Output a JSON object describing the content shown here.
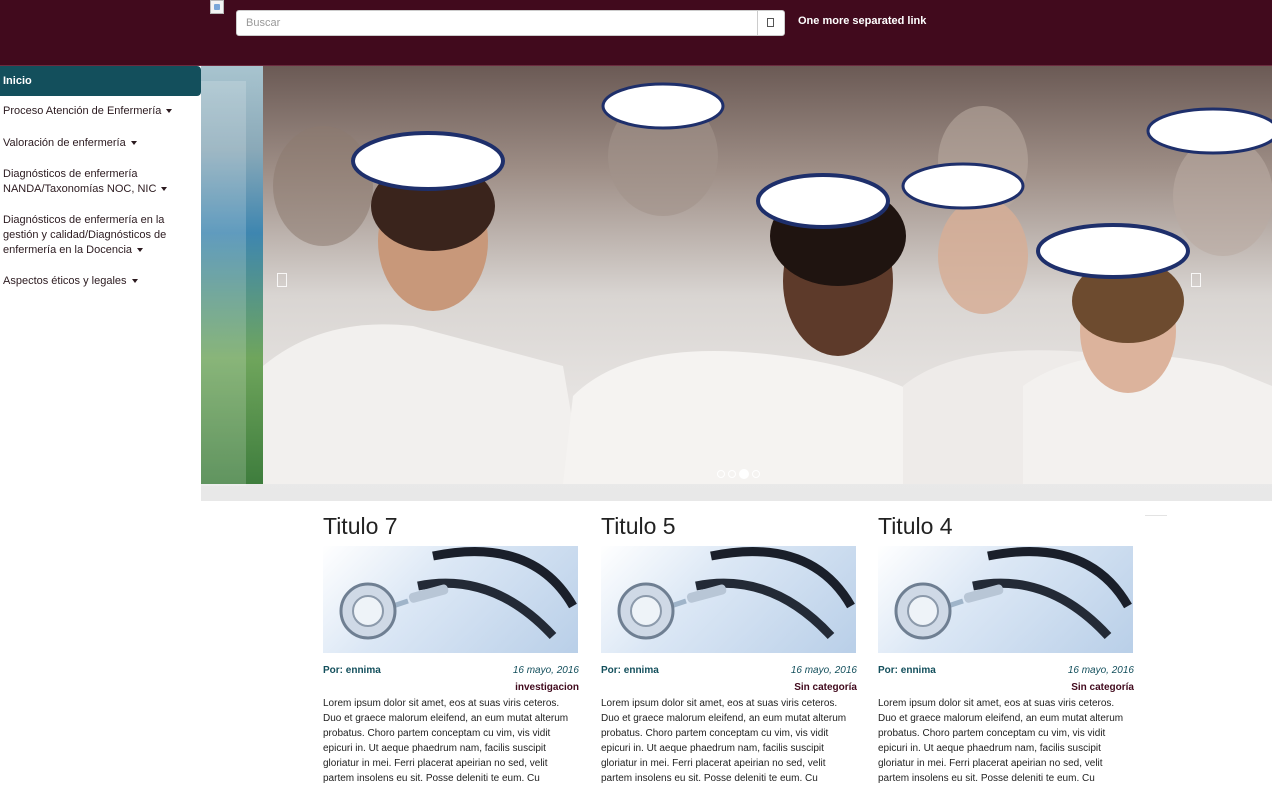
{
  "header": {
    "search_placeholder": "Buscar",
    "link": "One more separated link",
    "background_color": "#410a1d"
  },
  "sidebar": {
    "active_item": "Inicio",
    "items": [
      {
        "label": "Proceso Atención de Enfermería",
        "has_caret": true
      },
      {
        "label": "Valoración de enfermería",
        "has_caret": true
      },
      {
        "label": "Diagnósticos de enfermería NANDA/Taxonomías NOC, NIC",
        "has_caret": true
      },
      {
        "label": "Diagnósticos de enfermería en la gestión y calidad/Diagnósticos de enfermería en la Docencia",
        "has_caret": true
      },
      {
        "label": "Aspectos éticos y legales",
        "has_caret": true
      }
    ],
    "accent_color": "#134f5c"
  },
  "carousel": {
    "slide_description_icon": "nurses-photo",
    "indicator_count": 4,
    "active_indicator": 3
  },
  "posts": [
    {
      "title": "Titulo 7",
      "author": "Por: ennima",
      "date": "16 mayo, 2016",
      "category": "investigacion",
      "image_icon": "stethoscope-image",
      "excerpt": "Lorem ipsum dolor sit amet, eos at suas viris ceteros. Duo et graece malorum eleifend, an eum mutat alterum probatus. Choro partem conceptam cu vim, vis vidit epicuri in. Ut aeque phaedrum nam, facilis suscipit gloriatur in mei. Ferri placerat apeirian no sed, velit partem insolens eu sit. Posse deleniti te eum. Cu"
    },
    {
      "title": "Titulo 5",
      "author": "Por: ennima",
      "date": "16 mayo, 2016",
      "category": "Sin categoría",
      "image_icon": "stethoscope-image",
      "excerpt": "Lorem ipsum dolor sit amet, eos at suas viris ceteros. Duo et graece malorum eleifend, an eum mutat alterum probatus. Choro partem conceptam cu vim, vis vidit epicuri in. Ut aeque phaedrum nam, facilis suscipit gloriatur in mei. Ferri placerat apeirian no sed, velit partem insolens eu sit. Posse deleniti te eum. Cu"
    },
    {
      "title": "Titulo 4",
      "author": "Por: ennima",
      "date": "16 mayo, 2016",
      "category": "Sin categoría",
      "image_icon": "stethoscope-image",
      "excerpt": "Lorem ipsum dolor sit amet, eos at suas viris ceteros. Duo et graece malorum eleifend, an eum mutat alterum probatus. Choro partem conceptam cu vim, vis vidit epicuri in. Ut aeque phaedrum nam, facilis suscipit gloriatur in mei. Ferri placerat apeirian no sed, velit partem insolens eu sit. Posse deleniti te eum. Cu"
    }
  ]
}
